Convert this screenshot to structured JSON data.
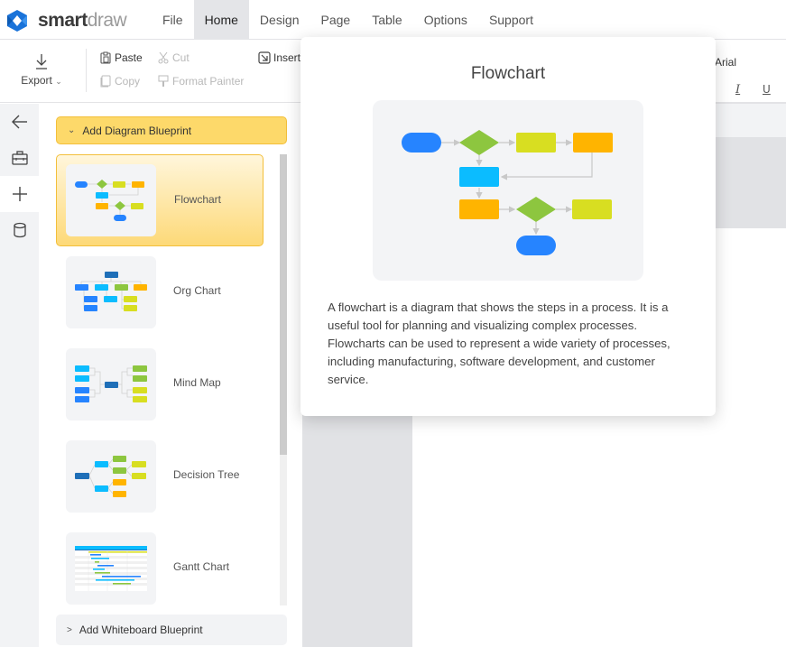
{
  "app": {
    "logo_main": "smart",
    "logo_accent": "draw"
  },
  "menu": {
    "items": [
      {
        "label": "File"
      },
      {
        "label": "Home",
        "active": true
      },
      {
        "label": "Design"
      },
      {
        "label": "Page"
      },
      {
        "label": "Table"
      },
      {
        "label": "Options"
      },
      {
        "label": "Support"
      }
    ]
  },
  "ribbon": {
    "export_label": "Export",
    "paste_label": "Paste",
    "cut_label": "Cut",
    "copy_label": "Copy",
    "format_painter_label": "Format Painter",
    "insert_label": "Insert",
    "font_value": "Arial",
    "italic_label": "I",
    "underline_label": "U"
  },
  "rail": {
    "items": [
      {
        "icon": "back-arrow-icon"
      },
      {
        "icon": "toolbox-icon"
      },
      {
        "icon": "plus-icon",
        "active": true
      },
      {
        "icon": "database-icon"
      }
    ]
  },
  "panel": {
    "diagram_header": "Add Diagram Blueprint",
    "whiteboard_header": "Add Whiteboard Blueprint",
    "blueprints": [
      {
        "label": "Flowchart",
        "selected": true
      },
      {
        "label": "Org Chart"
      },
      {
        "label": "Mind Map"
      },
      {
        "label": "Decision Tree"
      },
      {
        "label": "Gantt Chart"
      }
    ]
  },
  "popover": {
    "title": "Flowchart",
    "description": "A flowchart is a diagram that shows the steps in a process. It is a useful tool for planning and visualizing complex processes. Flowcharts can be used to represent a wide variety of processes, including manufacturing, software development, and customer service."
  },
  "colors": {
    "blue": "#2684ff",
    "cyan": "#0bbcff",
    "green": "#8dc63f",
    "yellow": "#d8de21",
    "orange": "#ffb400",
    "navy": "#1f6fb8",
    "header_yellow": "#fdd96a"
  }
}
